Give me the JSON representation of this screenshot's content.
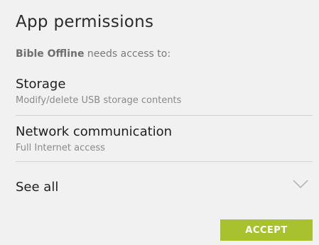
{
  "dialog": {
    "title": "App permissions",
    "app_name": "Bible Offline",
    "subtitle_suffix": " needs access to:"
  },
  "permissions": [
    {
      "title": "Storage",
      "description": "Modify/delete USB storage contents"
    },
    {
      "title": "Network communication",
      "description": "Full Internet access"
    }
  ],
  "see_all": {
    "label": "See all",
    "icon": "chevron-down-icon"
  },
  "actions": {
    "accept_label": "ACCEPT",
    "accept_color": "#a8c22f"
  }
}
